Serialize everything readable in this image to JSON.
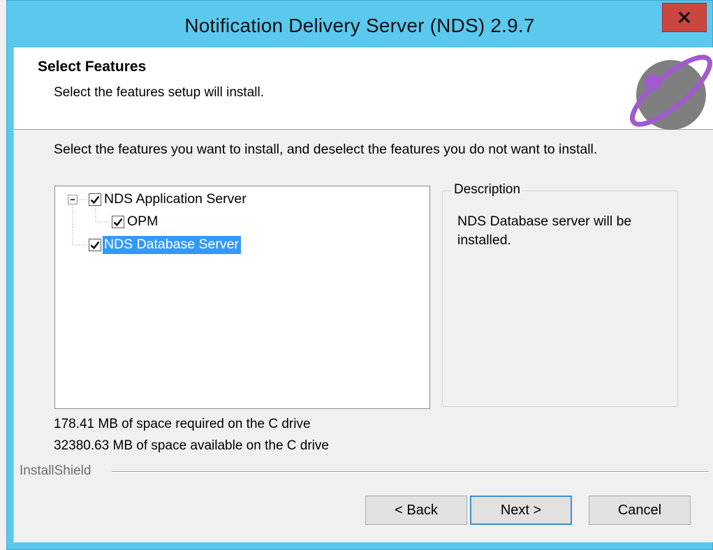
{
  "window": {
    "title": "Notification Delivery Server (NDS) 2.9.7",
    "close_icon": "close-icon"
  },
  "header": {
    "title": "Select Features",
    "subtitle": "Select the features setup will install."
  },
  "instruction": "Select the features you want to install, and deselect the features you do not want to install.",
  "feature_tree": {
    "items": [
      {
        "label": "NDS Application Server",
        "checked": true,
        "expanded": true,
        "level": 0,
        "selected": false
      },
      {
        "label": "OPM",
        "checked": true,
        "level": 1,
        "selected": false
      },
      {
        "label": "NDS Database Server",
        "checked": true,
        "level": 0,
        "selected": true
      }
    ]
  },
  "description": {
    "legend": "Description",
    "text": "NDS Database server will be installed."
  },
  "space": {
    "required": "178.41 MB of space required on the C drive",
    "available": "32380.63 MB of space available on the C drive"
  },
  "brand": "InstallShield",
  "buttons": {
    "back": "< Back",
    "next": "Next >",
    "cancel": "Cancel"
  },
  "colors": {
    "title_bar": "#5bc8ee",
    "close_button": "#c9473f",
    "selection": "#3399ff",
    "logo_orbit": "#a25ad0",
    "logo_globe": "#7f7f7f"
  }
}
